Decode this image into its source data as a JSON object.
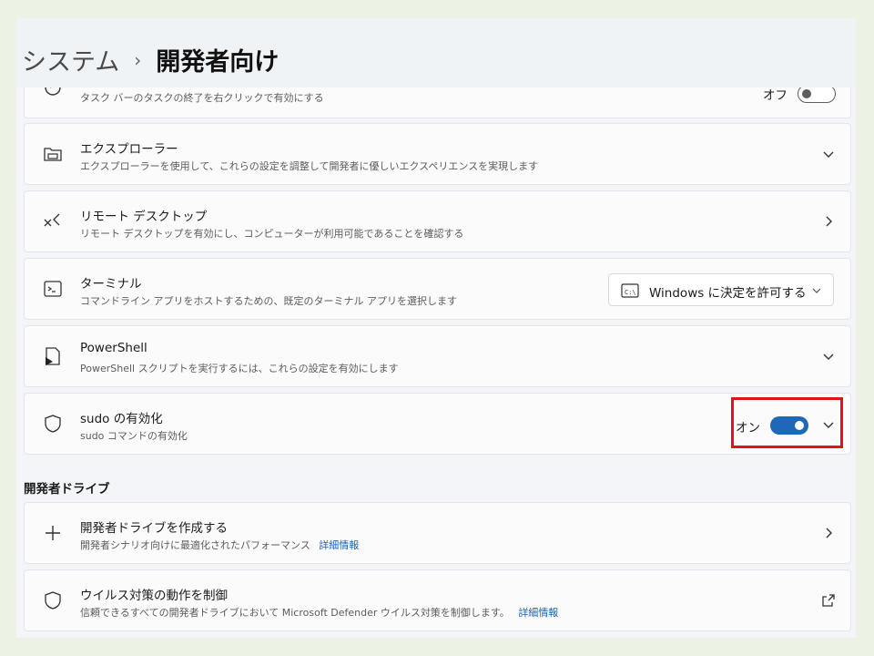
{
  "breadcrumb": {
    "parent": "システム",
    "separator": "›",
    "current": "開発者向け"
  },
  "rows": {
    "end_task": {
      "desc": "タスク バーのタスクの終了を右クリックで有効にする",
      "toggle_label": "オフ",
      "toggle_state": "off"
    },
    "explorer": {
      "title": "エクスプローラー",
      "desc": "エクスプローラーを使用して、これらの設定を調整して開発者に優しいエクスペリエンスを実現します",
      "icon": "folder-icon"
    },
    "remote_desktop": {
      "title": "リモート デスクトップ",
      "desc": "リモート デスクトップを有効にし、コンピューターが利用可能であることを確認する",
      "icon": "remote-desktop-icon"
    },
    "terminal": {
      "title": "ターミナル",
      "desc": "コマンドライン アプリをホストするための、既定のターミナル アプリを選択します",
      "icon": "terminal-icon",
      "dropdown_value": "Windows に決定を許可する"
    },
    "powershell": {
      "title": "PowerShell",
      "desc": "PowerShell スクリプトを実行するには、これらの設定を有効にします",
      "icon": "powershell-icon"
    },
    "sudo": {
      "title": "sudo の有効化",
      "desc": "sudo コマンドの有効化",
      "icon": "shield-icon",
      "toggle_label": "オン",
      "toggle_state": "on"
    }
  },
  "dev_drive": {
    "section_label": "開発者ドライブ",
    "create": {
      "title": "開発者ドライブを作成する",
      "desc": "開発者シナリオ向けに最適化されたパフォーマンス",
      "link": "詳細情報",
      "icon": "plus-icon"
    },
    "antivirus": {
      "title": "ウイルス対策の動作を制御",
      "desc": "信頼できるすべての開発者ドライブにおいて Microsoft Defender ウイルス対策を制御します。",
      "link": "詳細情報",
      "icon": "shield-icon"
    }
  },
  "colors": {
    "accent": "#1e68b7",
    "highlight": "#e0121a",
    "link": "#1a62b8"
  }
}
